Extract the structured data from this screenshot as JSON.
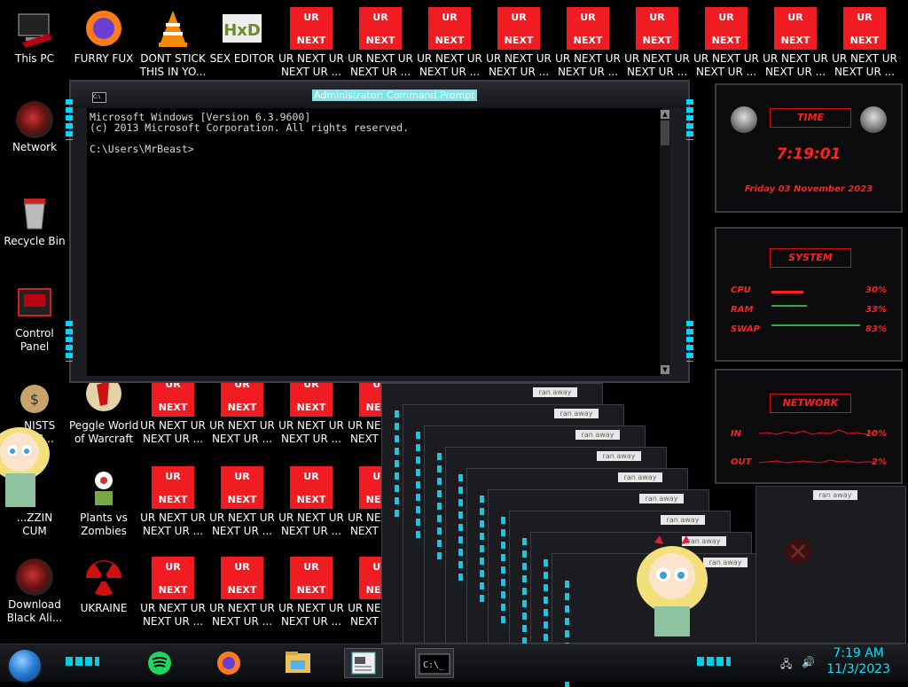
{
  "desktop": {
    "left_icons": [
      {
        "label": "This PC",
        "icon": "computer-icon"
      },
      {
        "label": "Network",
        "icon": "network-icon"
      },
      {
        "label": "Recycle Bin",
        "icon": "recycle-bin-icon"
      },
      {
        "label": "Control Panel",
        "icon": "control-panel-icon"
      },
      {
        "label": "...NISTS\n...S G...",
        "icon": "money-bag-icon"
      },
      {
        "label": "...ZZIN\nCUM",
        "icon": "cartoon-girl-icon"
      },
      {
        "label": "Download\nBlack Ali...",
        "icon": "alien-orb-icon"
      }
    ],
    "top_icons": [
      {
        "label": "FURRY FUX",
        "icon": "firefox-icon"
      },
      {
        "label": "DONT STICK\nTHIS IN YO...",
        "icon": "vlc-cone-icon"
      },
      {
        "label": "SEX EDITOR",
        "icon": "hxd-icon"
      }
    ],
    "col2_icons": [
      {
        "label": "Peggle World\nof Warcraft",
        "icon": "peggle-icon"
      },
      {
        "label": "Plants vs\nZombies",
        "icon": "plants-icon"
      },
      {
        "label": "UKRAINE",
        "icon": "radiation-icon"
      }
    ],
    "ur_box": {
      "top": "UR",
      "bottom": "NEXT",
      "label": "UR NEXT UR\nNEXT UR ..."
    },
    "ur_row_top_count": 9
  },
  "cmd": {
    "title": "Administrator: Command Prompt",
    "line1": "Microsoft Windows [Version 6.3.9600]",
    "line2": "(c) 2013 Microsoft Corporation. All rights reserved.",
    "prompt": "C:\\Users\\MrBeast>",
    "sys_icon": "C:\\"
  },
  "stacked_window_label": "ran away",
  "widgets": {
    "time": {
      "header": "TIME",
      "clock": "7:19:01",
      "date": "Friday 03 November 2023"
    },
    "system": {
      "header": "SYSTEM",
      "rows": [
        {
          "label": "CPU",
          "value": "30%",
          "fraction": 0.3
        },
        {
          "label": "RAM",
          "value": "33%",
          "fraction": 0.33
        },
        {
          "label": "SWAP",
          "value": "83%",
          "fraction": 0.83
        }
      ]
    },
    "network": {
      "header": "NETWORK",
      "in_label": "IN",
      "in_value": "10%",
      "out_label": "OUT",
      "out_value": "2%"
    }
  },
  "taskbar": {
    "time": "7:19 AM",
    "date": "11/3/2023",
    "apps": [
      "spotify-icon",
      "firefox-icon",
      "file-explorer-icon",
      "notepad-icon",
      "cmd-icon"
    ]
  },
  "colors": {
    "accent": "#00e5ff",
    "ur_red": "#f01c22",
    "widget_red": "#ff2020"
  }
}
